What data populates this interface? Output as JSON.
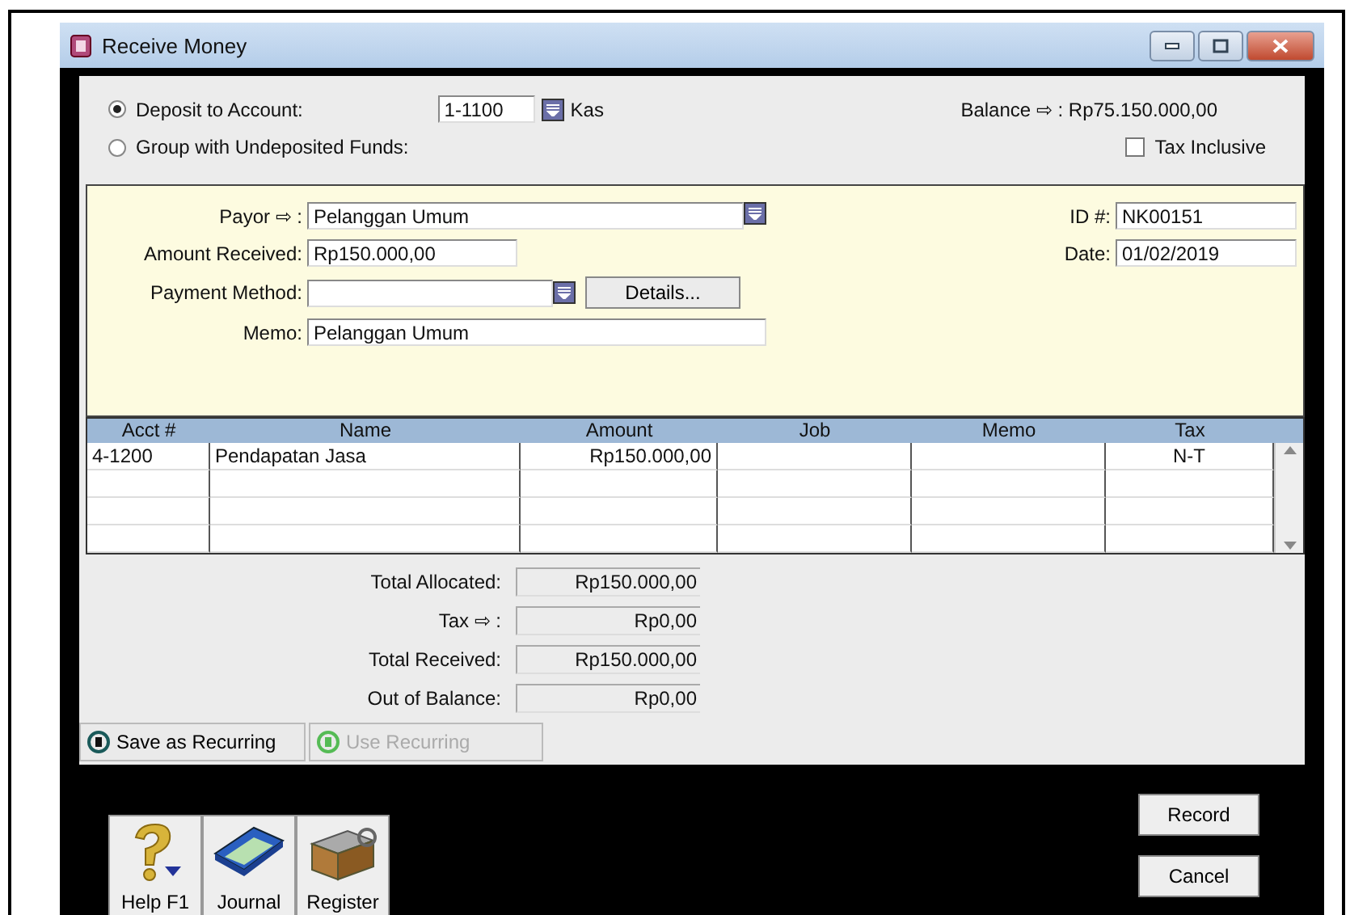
{
  "window": {
    "title": "Receive Money"
  },
  "deposit_options": [
    {
      "label": "Deposit to Account:",
      "selected": true
    },
    {
      "label": "Group with Undeposited Funds:",
      "selected": false
    }
  ],
  "account": {
    "number": "1-1100",
    "name": "Kas"
  },
  "balance": {
    "label": "Balance ⇨ :",
    "value": "Rp75.150.000,00"
  },
  "tax_inclusive": {
    "label": "Tax Inclusive",
    "checked": false
  },
  "payor": {
    "label": "Payor ⇨ :",
    "value": "Pelanggan Umum"
  },
  "id": {
    "label": "ID #:",
    "value": "NK00151"
  },
  "amount_received": {
    "label": "Amount Received:",
    "value": "Rp150.000,00"
  },
  "date": {
    "label": "Date:",
    "value": "01/02/2019"
  },
  "payment_method": {
    "label": "Payment Method:"
  },
  "details_button": "Details...",
  "memo": {
    "label": "Memo:",
    "value": "Pelanggan Umum"
  },
  "table": {
    "columns": [
      "Acct #",
      "Name",
      "Amount",
      "Job",
      "Memo",
      "Tax"
    ],
    "rows": [
      [
        "4-1200",
        "Pendapatan Jasa",
        "Rp150.000,00",
        "",
        "",
        "N-T"
      ]
    ]
  },
  "totals": [
    {
      "label": "Total Allocated:",
      "value": "Rp150.000,00"
    },
    {
      "label": "Tax ⇨ :",
      "value": "Rp0,00"
    },
    {
      "label": "Total Received:",
      "value": "Rp150.000,00"
    },
    {
      "label": "Out of Balance:",
      "value": "Rp0,00"
    }
  ],
  "recurring": [
    {
      "label": "Save as Recurring",
      "disabled": false
    },
    {
      "label": "Use Recurring",
      "disabled": true
    }
  ],
  "toolbar": [
    {
      "label": "Help F1",
      "kind": "help"
    },
    {
      "label": "Journal",
      "kind": "journal"
    },
    {
      "label": "Register",
      "kind": "register"
    }
  ],
  "actions": [
    "Record",
    "Cancel"
  ]
}
